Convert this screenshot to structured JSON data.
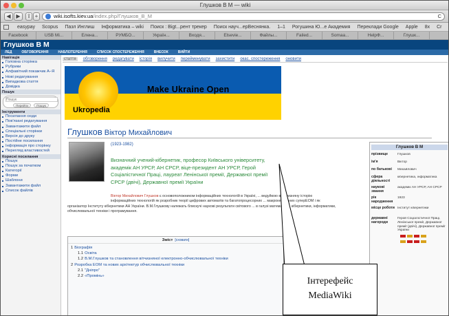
{
  "window": {
    "title": "Глушков В М — wiki"
  },
  "toolbar": {
    "back": "◀",
    "forward": "▶",
    "share": "⇪",
    "add": "+",
    "url_domain": "wiki.isofts.kiev.ua",
    "url_path": "/index.php/Глушков_В_М",
    "reload": "C"
  },
  "bookmarks": [
    "easypay",
    "Scopus",
    "Пазл Инглиш",
    "Інформатика – wiki",
    "Поиск : Bigt...рент трекер",
    "Поиск науч...ерВеснянка.",
    "1–1",
    "Рогушина Ю...е Академия",
    "Переклади Google",
    "Apple",
    "8x",
    "Cr"
  ],
  "tabs": [
    "Facebook",
    "USB Mi...",
    "Елена...",
    "РУМБО...",
    "Україн...",
    "Входя...",
    "Elsevie...",
    "Файлы...",
    "Failed...",
    "Somaa...",
    "НеlpФ...",
    "Глушк..."
  ],
  "wiki": {
    "site_title": "Глушков В М",
    "top_nav": [
      "ЛЕД",
      "ОБГОВОРЕННЯ",
      "НАБЛІЗТЕРЕННЯ",
      "СПИСОК СПОСТЕРЕЖЕННЯ",
      "ВНЕСОК",
      "ВИЙТИ"
    ]
  },
  "sidebar": {
    "nav_header": "Навігація",
    "nav_items": [
      "Головна сторінка",
      "Рубрики",
      "Алфавітний покажчик А–Я",
      "Нові редагування",
      "Випадкова стаття",
      "Довідка"
    ],
    "search_header": "Пошук",
    "search_placeholder": "Пошук",
    "go_button": "Перейти",
    "search_button": "Пошук",
    "tools_header": "Інструменти",
    "tools_items": [
      "Посилання сюди",
      "Пов'язані редагування",
      "Завантажити файл",
      "Спеціальні сторінки",
      "Версія до друку",
      "Постійне посилання",
      "Інформація про сторінку",
      "Перегляд властивостей"
    ],
    "useful_header": "Корисні посилання",
    "useful_items": [
      "Пошук",
      "Пошук за початком",
      "Категорії",
      "Форми",
      "Шаблони",
      "Завантажити файл",
      "Список файлів"
    ]
  },
  "action_tabs": [
    "стаття",
    "обговорення",
    "редагувати",
    "історія",
    "вилучити",
    "перейменувати",
    "захистити",
    "окас. спостереження",
    "оновити"
  ],
  "banner": {
    "main": "Make Ukraine Open",
    "sub": "Ukropedia"
  },
  "article": {
    "title": "Глушков",
    "title_rest": "Віктор Михайлович",
    "years": "(1923-1982)",
    "summary": "Визначний учений-кібернетик, професор Київського університету, академік АН УРСР, АН СРСР, віце-президент АН УРСР, Герой Соціалістичної Праці, лауреат Ленінської премії, Державної премії СРСР (двічі), Державної премії України",
    "para1_name": "Віктор",
    "para1_surname": "Михайлович Глушков",
    "para1": "є основоположником інформаційних технологій в Україні, ... ведуйкою в вітчизняну історію інформаційних технологій як розробник теорії цифрових автоматів та багатопроцесорних ... макрокерованих суперЕОМ і як",
    "para2": "організатор Інституту кібернетики АН України. В.М.Глушкову належать блискучі наукові результати світового ... в галузі математики, кібернетики, інформатики, обчислювальної техніки і програмування."
  },
  "toc": {
    "title": "Зміст",
    "toggle": "[сховати]",
    "items": [
      {
        "num": "1",
        "text": "Біографія",
        "level": 0
      },
      {
        "num": "1.1",
        "text": "Освіта",
        "level": 1
      },
      {
        "num": "1.2",
        "text": "В.М.Глушков та становлення вітчизняної електронно-обчислювальної техніки",
        "level": 1
      },
      {
        "num": "2",
        "text": "Розробка ЕОМ та нових архітектур обчислювальної техніки",
        "level": 0
      },
      {
        "num": "2.1",
        "text": "\"Дніпро\"",
        "level": 1
      },
      {
        "num": "2.2",
        "text": "«Промінь»",
        "level": 1
      }
    ]
  },
  "infobox": {
    "title": "Глушков В М",
    "rows": [
      {
        "label": "прізвище",
        "value": "Глушков"
      },
      {
        "label": "ім'я",
        "value": "Віктор"
      },
      {
        "label": "по батькові",
        "value": "Михайлович"
      },
      {
        "label": "сфера діяльності",
        "value": "кібернетика, інформатика"
      },
      {
        "label": "наукові звання",
        "value": "академік АН УРСР, АН СРСР"
      },
      {
        "label": "рік народження",
        "value": "1923"
      },
      {
        "label": "місце роботи",
        "value": "Інститут кібернетики"
      },
      {
        "label": "державні нагороди",
        "value": "Герой Соціалістичної Праці, Ленінської премії, Державної премії (двічі), Державної премії України"
      }
    ]
  },
  "callout": {
    "line1": "Інтерефейс",
    "line2": "MediaWiki"
  },
  "colors": {
    "header": "#08457e",
    "nav": "#2b6aa7",
    "link": "#1a4fa0",
    "summary": "#2a8a3a",
    "banner_blue": "#0a5bb0",
    "banner_yellow": "#ffd200"
  }
}
